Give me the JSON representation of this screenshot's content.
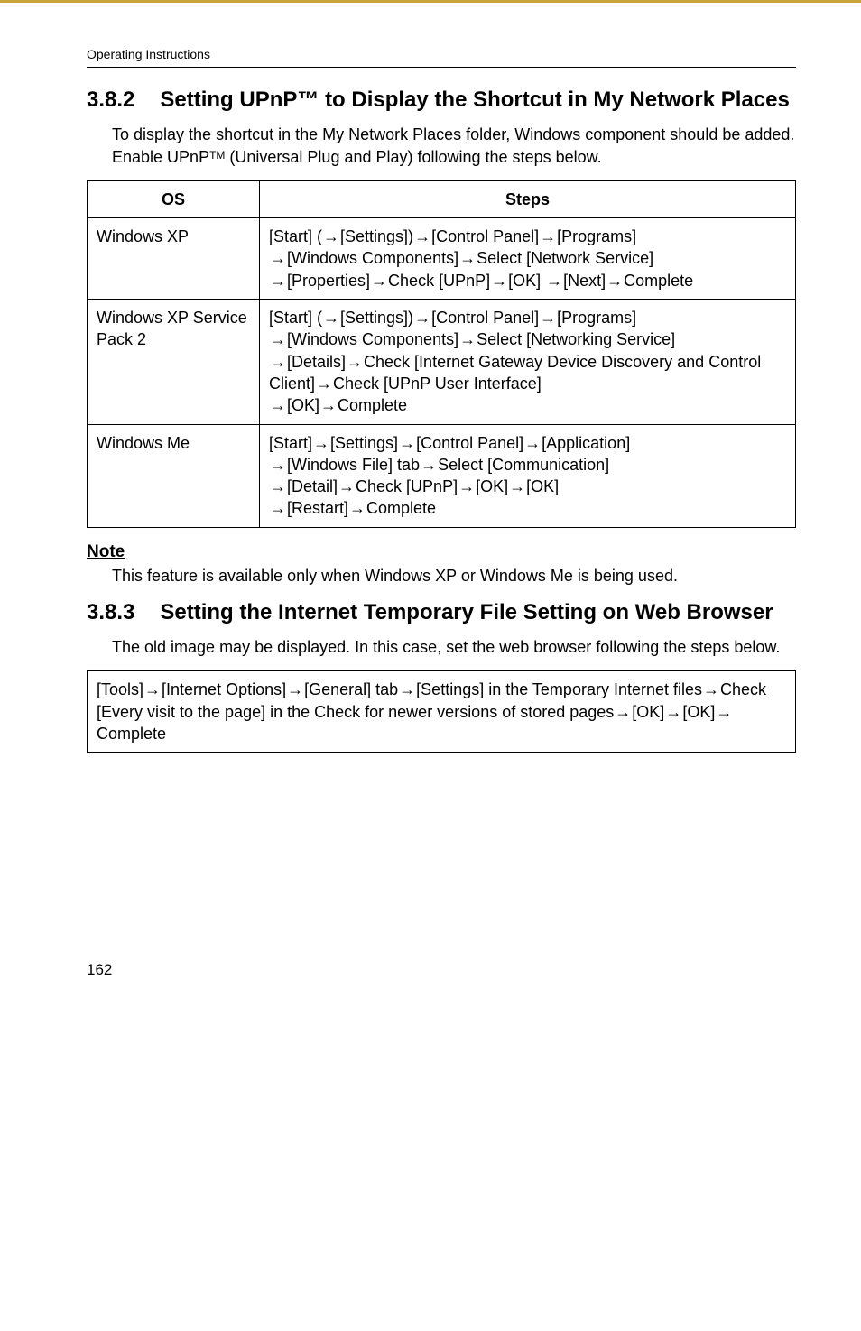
{
  "running_head": "Operating Instructions",
  "section_382": {
    "number": "3.8.2",
    "title": "Setting UPnP™ to Display the Shortcut in My Network Places",
    "intro": "To display the shortcut in the My Network Places folder, Windows component should be added. Enable UPnP",
    "intro_tm_suffix": "TM",
    "intro_tail": " (Universal Plug and Play) following the steps below."
  },
  "table": {
    "headers": {
      "os": "OS",
      "steps": "Steps"
    },
    "rows": [
      {
        "os": "Windows XP",
        "steps": "[Start] (→[Settings])→[Control Panel]→[Programs]\n→[Windows Components]→Select [Network Service]\n→[Properties]→Check [UPnP]→[OK] →[Next]→Complete"
      },
      {
        "os": "Windows XP Service Pack 2",
        "steps": "[Start] (→[Settings])→[Control Panel]→[Programs]\n→[Windows Components]→Select [Networking Service]\n→[Details]→Check [Internet Gateway Device Discovery and Control Client]→Check [UPnP User Interface]\n→[OK]→Complete"
      },
      {
        "os": "Windows Me",
        "steps": "[Start]→[Settings]→[Control Panel]→[Application]\n→[Windows File] tab→Select [Communication]\n→[Detail]→Check [UPnP]→[OK]→[OK]\n→[Restart]→Complete"
      }
    ]
  },
  "note": {
    "head": "Note",
    "body": "This feature is available only when Windows XP or Windows Me is being used."
  },
  "section_383": {
    "number": "3.8.3",
    "title": "Setting the Internet Temporary File Setting on Web Browser",
    "intro": "The old image may be displayed. In this case, set the web browser following the steps below."
  },
  "box_text": "[Tools]→[Internet Options]→[General] tab→[Settings] in the Temporary Internet files→Check [Every visit to the page] in the Check for newer versions of stored pages→[OK]→[OK]→Complete",
  "page_number": "162"
}
